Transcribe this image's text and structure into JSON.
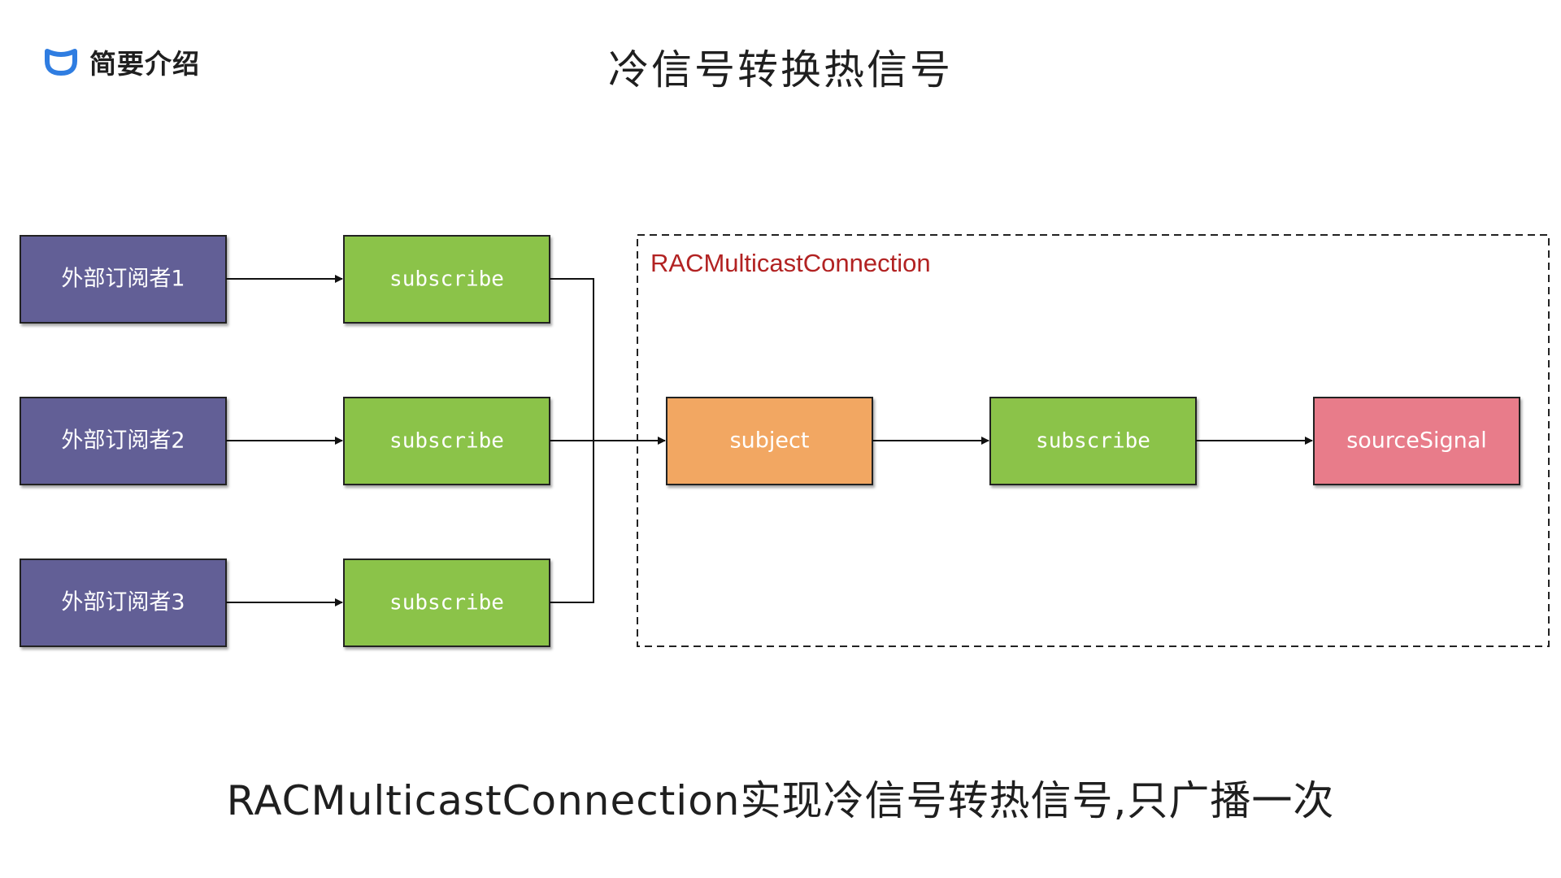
{
  "header": {
    "brand_label": "简要介绍",
    "title": "冷信号转换热信号"
  },
  "diagram": {
    "group_label": "RACMulticastConnection",
    "subscribers": [
      "外部订阅者1",
      "外部订阅者2",
      "外部订阅者3"
    ],
    "subscribe_label": "subscribe",
    "subject_label": "subject",
    "inner_subscribe_label": "subscribe",
    "source_label": "sourceSignal"
  },
  "caption": "RACMulticastConnection实现冷信号转热信号,只广播一次",
  "colors": {
    "subscriber_fill": "#625f96",
    "subscribe_fill": "#8bc34a",
    "subject_fill": "#f2a762",
    "source_fill": "#e87b8a",
    "group_label": "#b22222",
    "brand_icon": "#2f7de1"
  }
}
